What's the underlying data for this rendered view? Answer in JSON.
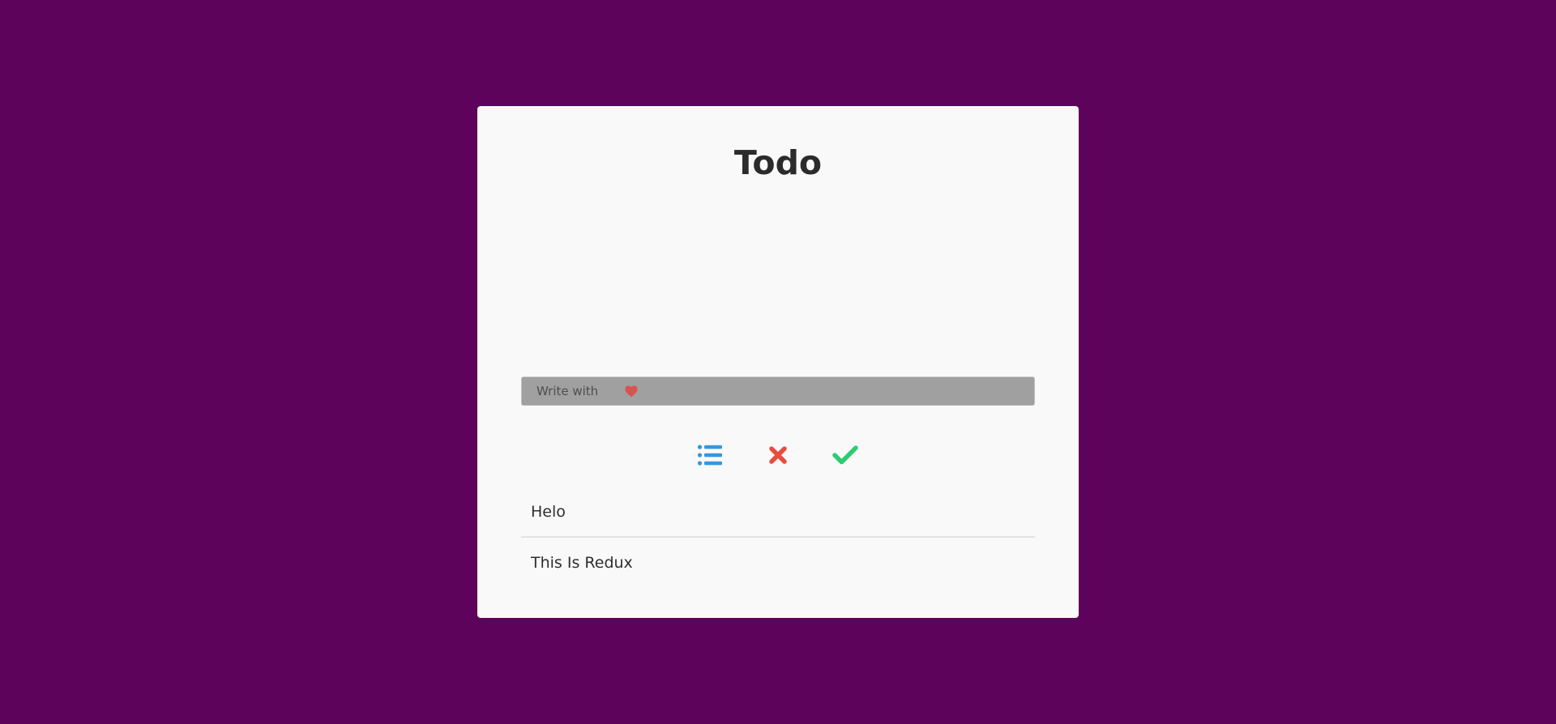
{
  "app": {
    "title": "Todo"
  },
  "input": {
    "placeholder": "Write with",
    "value": ""
  },
  "filters": [
    {
      "icon": "list-icon",
      "color": "#3498db"
    },
    {
      "icon": "close-icon",
      "color": "#e74c3c"
    },
    {
      "icon": "check-icon",
      "color": "#2ecc71"
    }
  ],
  "todos": [
    {
      "text": "Helo"
    },
    {
      "text": "This Is Redux"
    }
  ],
  "colors": {
    "background": "#5e035b",
    "card": "#f9f9f9",
    "heart": "#d9534f"
  }
}
